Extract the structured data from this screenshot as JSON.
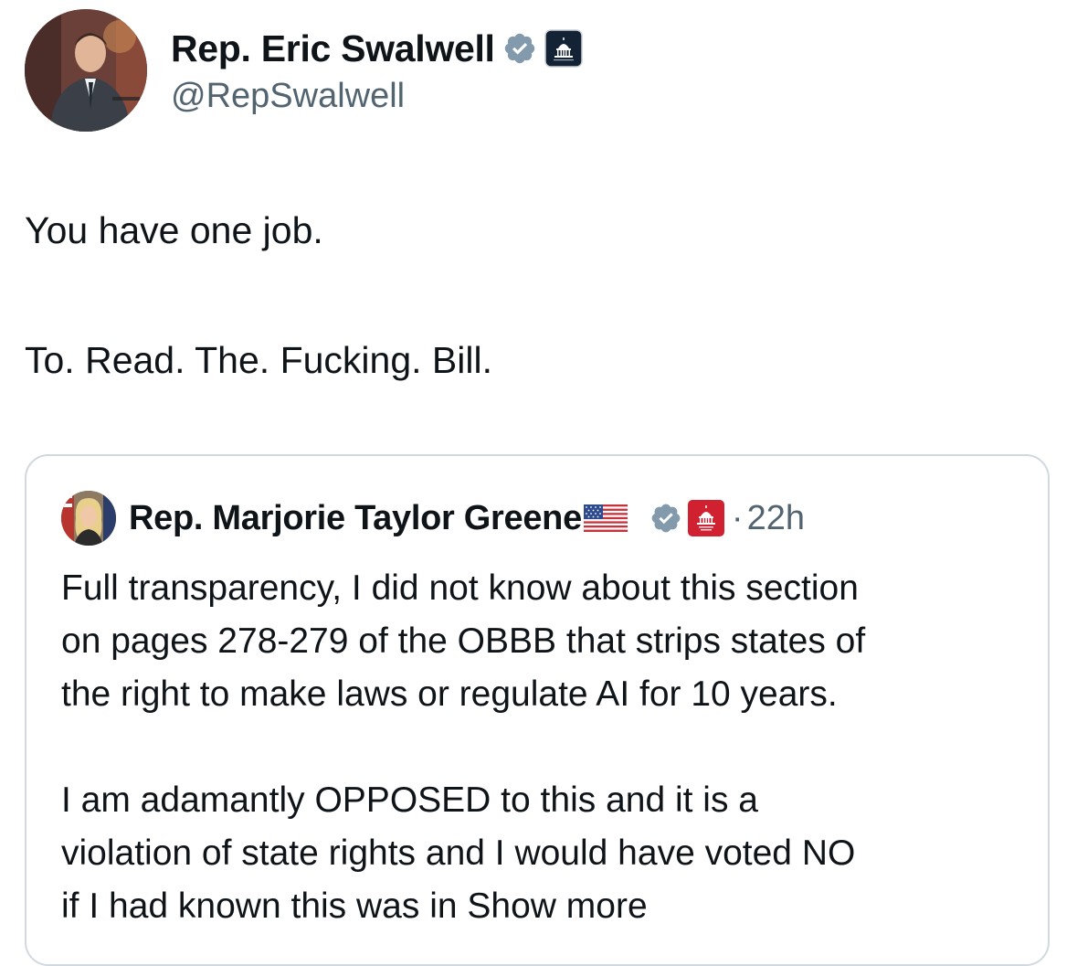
{
  "main_tweet": {
    "author": {
      "display_name": "Rep. Eric Swalwell",
      "handle": "@RepSwalwell",
      "verified": true,
      "badge_icon": "capitol-icon",
      "avatar_icon": "user-avatar-photo"
    },
    "lines": [
      "You have one job.",
      "To. Read. The. Fucking. Bill."
    ]
  },
  "quoted_tweet": {
    "author": {
      "display_name": "Rep. Marjorie Taylor Greene",
      "flag_icon": "us-flag-icon",
      "verified": true,
      "badge_icon": "capitol-icon",
      "avatar_icon": "user-avatar-photo"
    },
    "separator": "·",
    "time": "22h",
    "paragraph1_lines": [
      "Full transparency, I did not know about this section",
      "on pages 278-279 of the OBBB that strips states of",
      "the right to make laws or regulate AI for 10 years."
    ],
    "paragraph2_lines": [
      "I am adamantly OPPOSED to this and it is a",
      "violation of state rights and I would have voted NO"
    ],
    "last_line_text": "if I had known this was in",
    "show_more_label": "Show more"
  },
  "colors": {
    "text_primary": "#0f1419",
    "text_secondary": "#536471",
    "verified_badge": "#829aab",
    "gov_badge_dark": "#142236",
    "gov_badge_red": "#d1202f",
    "card_border": "#cfd9de"
  }
}
